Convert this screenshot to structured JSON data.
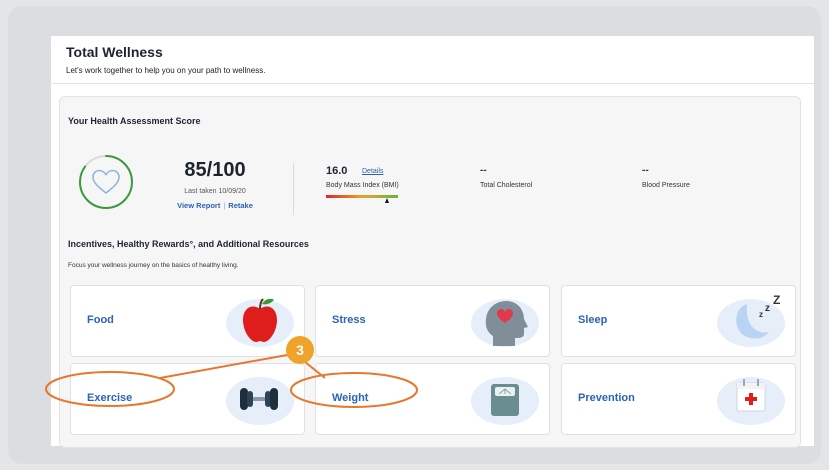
{
  "header": {
    "title": "Total Wellness",
    "subtitle": "Let's work together to help you on your path to wellness."
  },
  "assessment": {
    "heading": "Your Health Assessment Score",
    "score": "85/100",
    "last_taken": "Last taken 10/09/20",
    "view_report": "View Report",
    "separator": "|",
    "retake": "Retake",
    "score_fraction": 0.85
  },
  "metrics": {
    "bmi_value": "16.0",
    "bmi_details": "Details",
    "bmi_label": "Body Mass Index (BMI)",
    "cholesterol_value": "--",
    "cholesterol_label": "Total Cholesterol",
    "blood_pressure_value": "--",
    "blood_pressure_label": "Blood Pressure"
  },
  "resources": {
    "heading": "Incentives, Healthy Rewards°, and Additional Resources",
    "subtitle": "Focus your wellness journey on the basics of healthy living.",
    "cards": [
      {
        "label": "Food",
        "icon": "apple-icon"
      },
      {
        "label": "Stress",
        "icon": "head-heart-icon"
      },
      {
        "label": "Sleep",
        "icon": "moon-zzz-icon"
      },
      {
        "label": "Exercise",
        "icon": "dumbbell-icon"
      },
      {
        "label": "Weight",
        "icon": "scale-icon"
      },
      {
        "label": "Prevention",
        "icon": "calendar-medical-icon"
      }
    ]
  },
  "annotation": {
    "callout_number": "3",
    "color": "#e8772e"
  },
  "colors": {
    "link": "#2b63b6",
    "score_ring": "#3c9a3c",
    "callout_badge": "#f0a32a",
    "icon_blob": "#e6eefa"
  }
}
